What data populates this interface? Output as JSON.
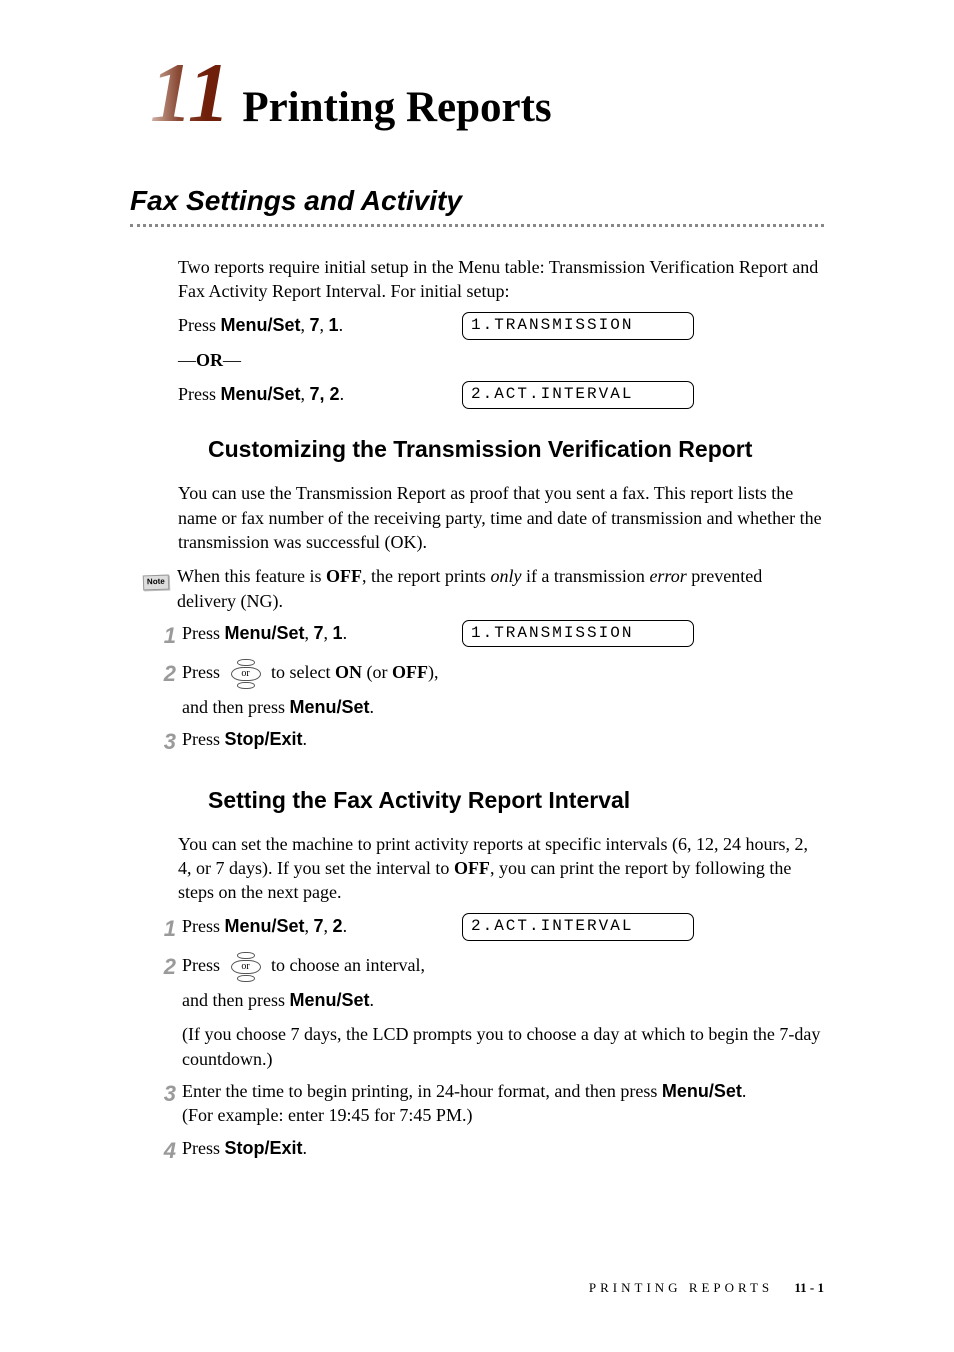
{
  "chapter": {
    "number": "11",
    "title": "Printing Reports"
  },
  "section1": {
    "title": "Fax Settings and Activity",
    "intro": "Two reports require initial setup in the Menu table: Transmission Verification Report and Fax Activity Report Interval. For initial setup:",
    "press1_pre": "Press ",
    "press1_keys": "Menu/Set",
    "press1_post": ", ",
    "press1_k7": "7",
    "press1_comma2": ", ",
    "press1_k1": "1",
    "press1_dot": ".",
    "lcd1": "1.TRANSMISSION",
    "or": "—",
    "or_bold": "OR",
    "or_end": "—",
    "press2_pre": "Press ",
    "press2_keys": "Menu/Set",
    "press2_post": ", ",
    "press2_k72": "7, 2",
    "press2_dot": ".",
    "lcd2": "2.ACT.INTERVAL"
  },
  "sub1": {
    "title": "Customizing the Transmission Verification Report",
    "p1": "You can use the Transmission Report as proof that you sent a fax. This report lists the name or fax number of the receiving party, time and date of transmission and whether the transmission was successful (OK).",
    "note_label": "Note",
    "note_p1a": "When this feature is ",
    "note_off": "OFF",
    "note_p1b": ", the report prints ",
    "note_only": "only",
    "note_p1c": " if a transmission ",
    "note_error": "error",
    "note_p1d": " prevented delivery (NG).",
    "step1_pre": "Press ",
    "step1_ms": "Menu/Set",
    "step1_c1": ", ",
    "step1_7": "7",
    "step1_c2": ", ",
    "step1_1": "1",
    "step1_dot": ".",
    "lcd": "1.TRANSMISSION",
    "step2_pre": "Press ",
    "or_label": "or",
    "step2_mid": " to select ",
    "step2_on": "ON",
    "step2_paren1": " (or ",
    "step2_off": "OFF",
    "step2_paren2": "),",
    "step2_line2a": "and then press ",
    "step2_ms": "Menu/Set",
    "step2_dot": ".",
    "step3_pre": "Press ",
    "step3_se": "Stop/Exit",
    "step3_dot": ".",
    "n1": "1",
    "n2": "2",
    "n3": "3"
  },
  "sub2": {
    "title": "Setting the Fax Activity Report Interval",
    "p1a": "You can set the machine to print activity reports at specific intervals (6, 12, 24 hours, 2, 4, or 7 days). If you set the interval to ",
    "p1_off": "OFF",
    "p1b": ", you can print the report by following the steps on the next page.",
    "step1_pre": "Press ",
    "step1_ms": "Menu/Set",
    "step1_c1": ", ",
    "step1_7": "7",
    "step1_c2": ", ",
    "step1_2": "2",
    "step1_dot": ".",
    "lcd": "2.ACT.INTERVAL",
    "step2_pre": "Press ",
    "or_label": "or",
    "step2_mid": " to choose an interval,",
    "step2_line2a": "and then press ",
    "step2_ms": "Menu/Set",
    "step2_dot": ".",
    "step2_paren": "(If you choose 7 days, the LCD prompts you to choose a day at which to begin the 7-day countdown.)",
    "step3_a": "Enter the time to begin printing, in 24-hour format, and then press ",
    "step3_ms": "Menu/Set",
    "step3_dot": ".",
    "step3_paren": "(For example: enter 19:45 for 7:45 PM.)",
    "step4_pre": "Press ",
    "step4_se": "Stop/Exit",
    "step4_dot": ".",
    "n1": "1",
    "n2": "2",
    "n3": "3",
    "n4": "4"
  },
  "footer": {
    "label": "PRINTING REPORTS",
    "page": "11 - 1"
  }
}
